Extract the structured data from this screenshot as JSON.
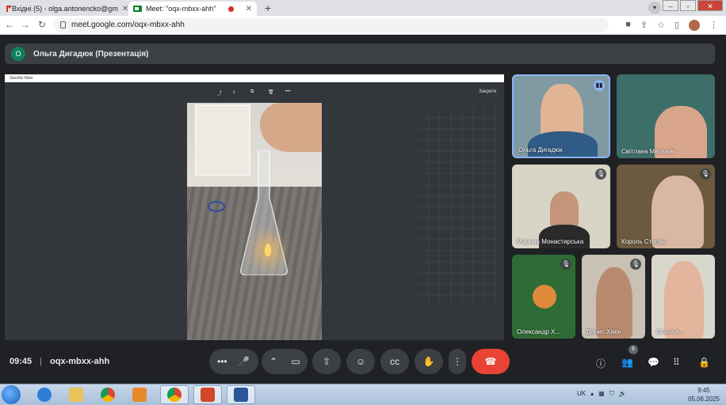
{
  "browser": {
    "tabs": [
      {
        "title": "Вхідні (5) - olga.antonencko@gm",
        "active": false
      },
      {
        "title": "Meet: \"oqx-mbxx-ahh\"",
        "active": true
      }
    ],
    "url": "meet.google.com/oqx-mbxx-ahh"
  },
  "presentation": {
    "avatar_letter": "О",
    "title": "Ольга Дигадюк (Презентація)",
    "viewer_window_title": "Засоби Viber",
    "viewer_close_label": "Закрити"
  },
  "participants": [
    {
      "name": "Ольга Дигадюк",
      "speaking": true,
      "muted": false
    },
    {
      "name": "Світлана Мельник",
      "speaking": false,
      "muted": false
    },
    {
      "name": "Марина Монастирська",
      "speaking": false,
      "muted": true
    },
    {
      "name": "Король Степан",
      "speaking": false,
      "muted": true
    },
    {
      "name": "Олександр Х...",
      "speaking": false,
      "muted": true
    },
    {
      "name": "Денис Хімін",
      "speaking": false,
      "muted": true
    },
    {
      "name": "Ольга А...",
      "speaking": false,
      "muted": false
    }
  ],
  "meeting": {
    "time": "09:45",
    "code": "oqx-mbxx-ahh",
    "people_count": "8"
  },
  "colors": {
    "end_call": "#ea4335",
    "meet_bg": "#202124",
    "speaking_ring": "#8ab4f8"
  },
  "taskbar": {
    "language": "UK",
    "clock_time": "9:45",
    "clock_date": "05.06.2025"
  }
}
